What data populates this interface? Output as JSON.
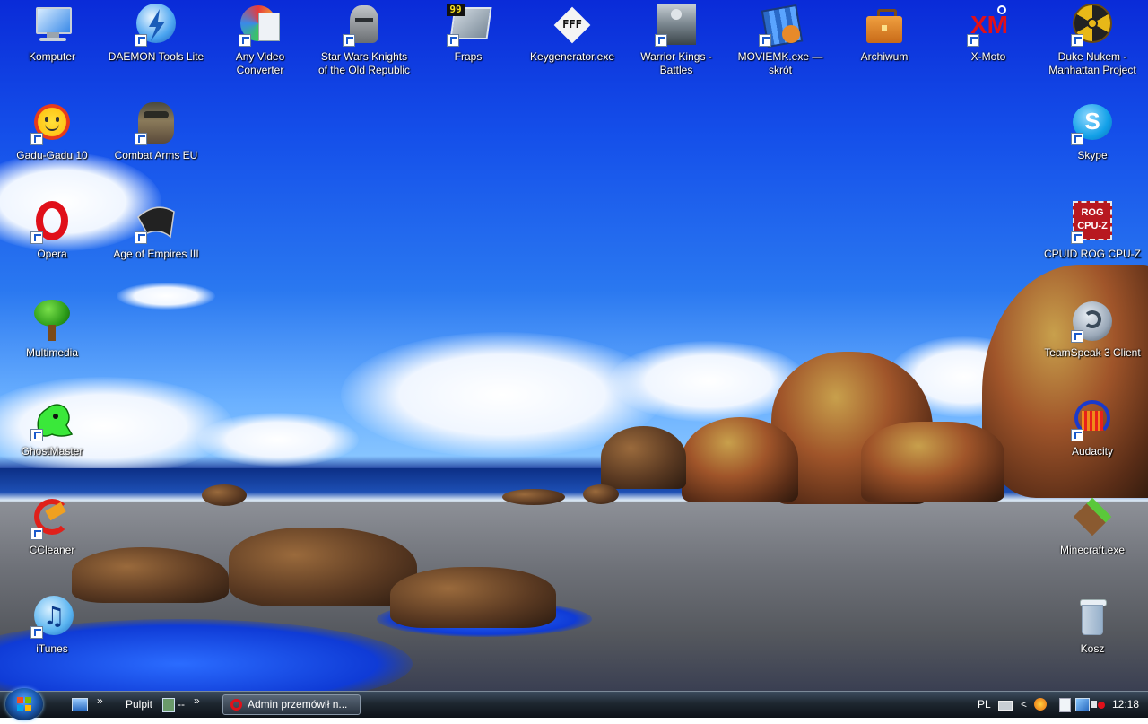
{
  "desktop": {
    "icons": [
      {
        "label": "Komputer",
        "icon": "computer-icon"
      },
      {
        "label": "DAEMON Tools Lite",
        "icon": "daemon-tools-icon"
      },
      {
        "label": "Any Video Converter",
        "icon": "video-converter-icon"
      },
      {
        "label": "Star Wars Knights of the Old Republic",
        "icon": "kotor-icon"
      },
      {
        "label": "Fraps",
        "icon": "fraps-icon"
      },
      {
        "label": "Keygenerator.exe",
        "icon": "keygen-icon"
      },
      {
        "label": "Warrior Kings - Battles",
        "icon": "warrior-kings-icon"
      },
      {
        "label": "MOVIEMK.exe — skrót",
        "icon": "moviemk-icon"
      },
      {
        "label": "Archiwum",
        "icon": "briefcase-icon"
      },
      {
        "label": "X-Moto",
        "icon": "xmoto-icon"
      },
      {
        "label": "Duke Nukem - Manhattan Project",
        "icon": "duke-nukem-icon"
      },
      {
        "label": "Gadu-Gadu 10",
        "icon": "gadu-gadu-icon"
      },
      {
        "label": "Combat Arms EU",
        "icon": "combat-arms-icon"
      },
      {
        "label": "Skype",
        "icon": "skype-icon"
      },
      {
        "label": "Opera",
        "icon": "opera-icon"
      },
      {
        "label": "Age of Empires III",
        "icon": "aoe3-icon"
      },
      {
        "label": "CPUID ROG CPU-Z",
        "icon": "cpuz-icon"
      },
      {
        "label": "Multimedia",
        "icon": "tree-icon"
      },
      {
        "label": "TeamSpeak 3 Client",
        "icon": "teamspeak-icon"
      },
      {
        "label": "GhostMaster",
        "icon": "ghostmaster-icon"
      },
      {
        "label": "Audacity",
        "icon": "audacity-icon"
      },
      {
        "label": "CCleaner",
        "icon": "ccleaner-icon"
      },
      {
        "label": "Minecraft.exe",
        "icon": "minecraft-icon"
      },
      {
        "label": "iTunes",
        "icon": "itunes-icon"
      },
      {
        "label": "Kosz",
        "icon": "recycle-bin-icon"
      }
    ]
  },
  "taskbar": {
    "toolbar_label": "Pulpit",
    "toolbar_dashes": "--",
    "chevron": "»",
    "window_button_label": "Admin przemówił n...",
    "language": "PL",
    "clock": "12:18",
    "tray_chevron": "<"
  },
  "colors": {
    "taskbar": "#1e2730",
    "sky": "#1550ea",
    "label_text": "#ffffff"
  }
}
